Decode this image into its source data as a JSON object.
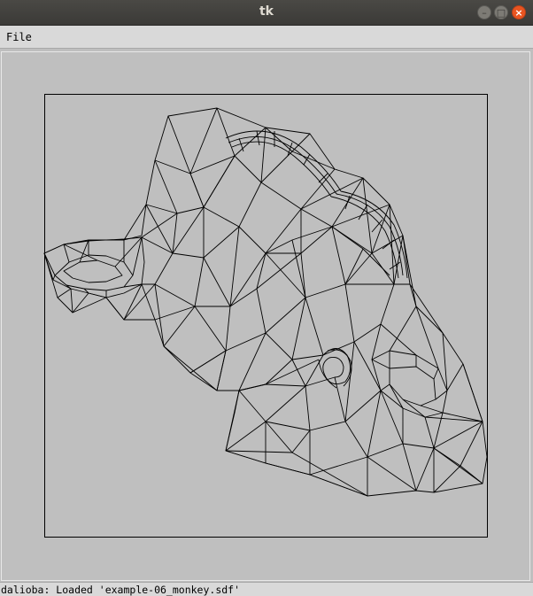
{
  "window": {
    "title": "tk"
  },
  "menu": {
    "items": [
      "File"
    ]
  },
  "status": {
    "text": "dalioba: Loaded 'example-06_monkey.sdf'"
  },
  "canvas": {
    "background": "#bfbfbf",
    "line_color": "#000000"
  },
  "icons": {
    "minimize": "minimize-icon",
    "maximize": "maximize-icon",
    "close": "close-icon"
  }
}
